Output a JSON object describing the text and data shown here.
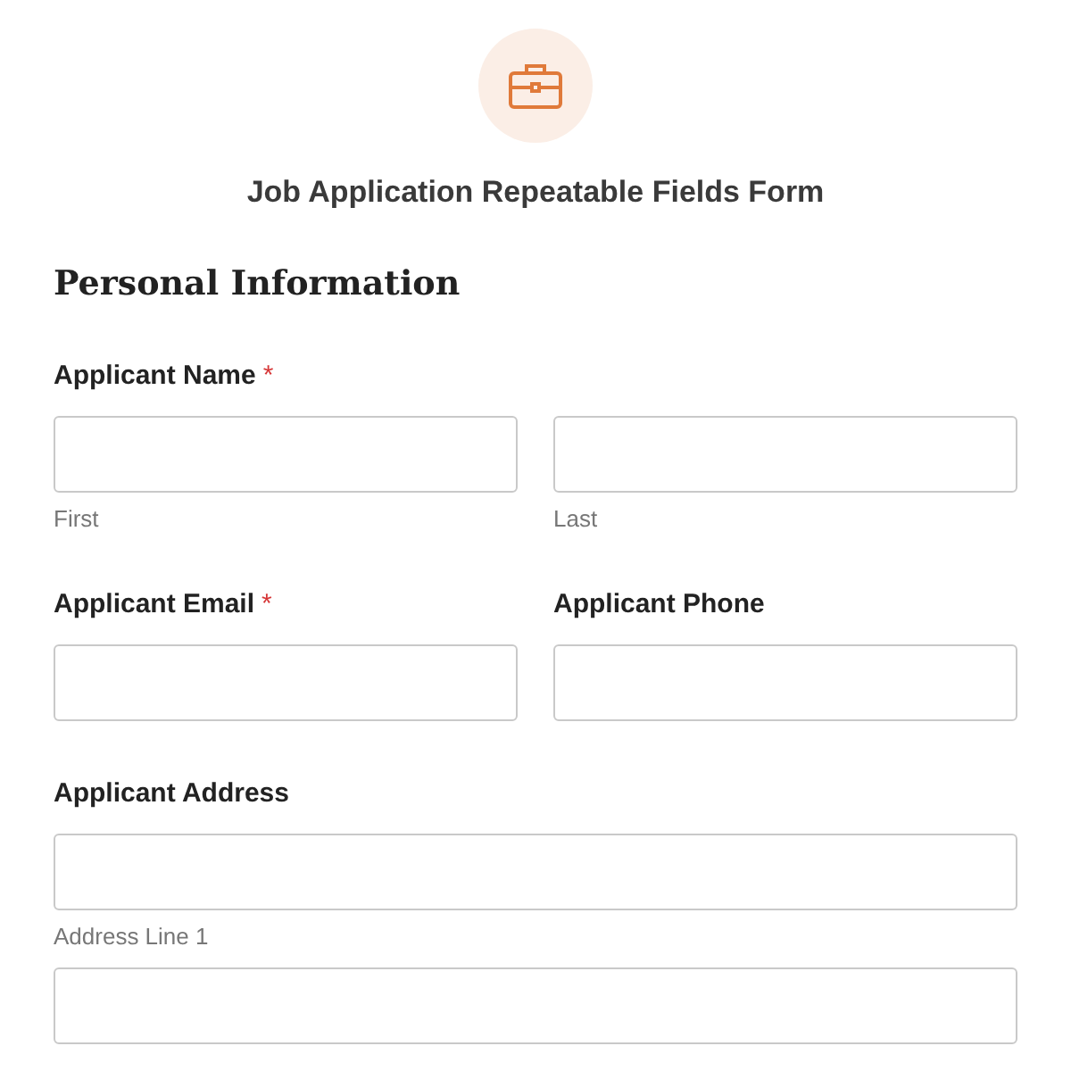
{
  "form": {
    "title": "Job Application Repeatable Fields Form"
  },
  "section": {
    "title": "Personal Information"
  },
  "rows": [
    {
      "kind": "split",
      "columns": [
        {
          "label": "Applicant Name",
          "required_mark": "*",
          "sublabels": [
            "First",
            "Last"
          ]
        }
      ]
    },
    {
      "kind": "pair",
      "columns": [
        {
          "label": "Applicant Email",
          "required_mark": "*"
        },
        {
          "label": "Applicant Phone"
        }
      ]
    },
    {
      "kind": "stacked",
      "columns": [
        {
          "label": "Applicant Address",
          "sublabels": [
            "Address Line 1"
          ]
        }
      ]
    }
  ]
}
